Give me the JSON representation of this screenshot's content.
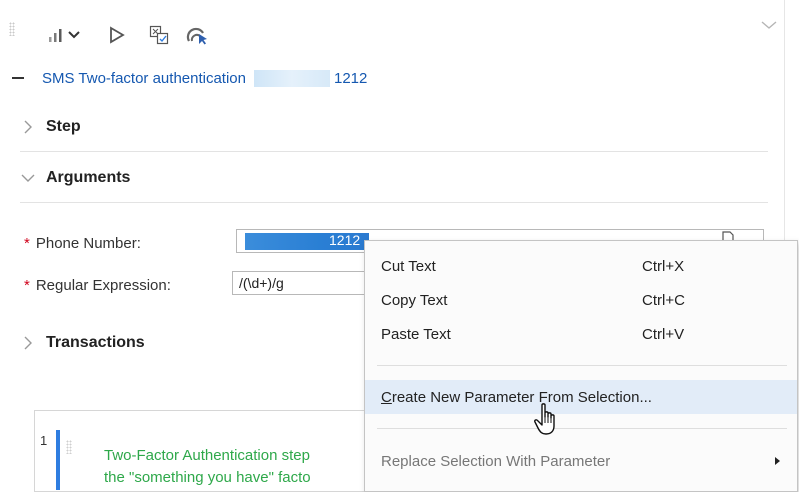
{
  "toolbar": {
    "icons": [
      "bar-chart-icon",
      "chevron-down-icon",
      "play-icon",
      "compare-icon",
      "record-icon"
    ]
  },
  "header": {
    "title_label": "SMS Two-factor authentication",
    "title_suffix": "1212"
  },
  "sections": {
    "step": "Step",
    "arguments": "Arguments",
    "transactions": "Transactions"
  },
  "arguments": {
    "phone": {
      "required_mark": "*",
      "label": "Phone Number:",
      "value_visible": "1212"
    },
    "regex": {
      "required_mark": "*",
      "label": "Regular Expression:",
      "value": "/(\\d+)/g"
    }
  },
  "code": {
    "line_number": "1",
    "line1": "Two-Factor Authentication step",
    "line2": "the \"something you have\" facto"
  },
  "context_menu": {
    "items": [
      {
        "label": "Cut Text",
        "shortcut": "Ctrl+X"
      },
      {
        "label": "Copy Text",
        "shortcut": "Ctrl+C"
      },
      {
        "label": "Paste Text",
        "shortcut": "Ctrl+V"
      },
      {
        "label_first": "C",
        "label_rest": "reate New Parameter From Selection...",
        "highlighted": true
      },
      {
        "label": "Replace Selection With Parameter",
        "disabled": true,
        "has_submenu": true
      }
    ]
  },
  "colors": {
    "link": "#1558b0",
    "selection": "#2a7fd4",
    "required": "#d0021b",
    "code_text": "#2ea84a",
    "menu_highlight": "#e2ecf8"
  }
}
